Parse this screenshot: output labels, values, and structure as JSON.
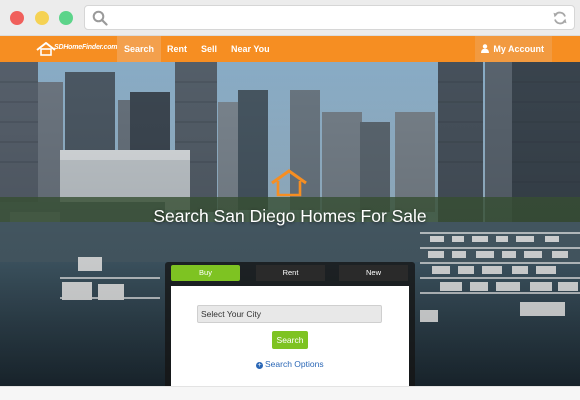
{
  "nav": {
    "logo_text": "SDHomeFinder.com",
    "items": [
      {
        "label": "Search"
      },
      {
        "label": "Rent"
      },
      {
        "label": "Sell"
      },
      {
        "label": "Near You"
      }
    ],
    "account_label": "My Account"
  },
  "hero": {
    "title": "Search San Diego Homes For Sale"
  },
  "search": {
    "tabs": [
      {
        "label": "Buy"
      },
      {
        "label": "Rent"
      },
      {
        "label": "New"
      }
    ],
    "city_value": "Select Your City",
    "search_label": "Search",
    "options_label": "Search Options"
  },
  "colors": {
    "nav_orange": "#f68e22",
    "accent_green": "#7ec322",
    "link_blue": "#2a67b6"
  }
}
